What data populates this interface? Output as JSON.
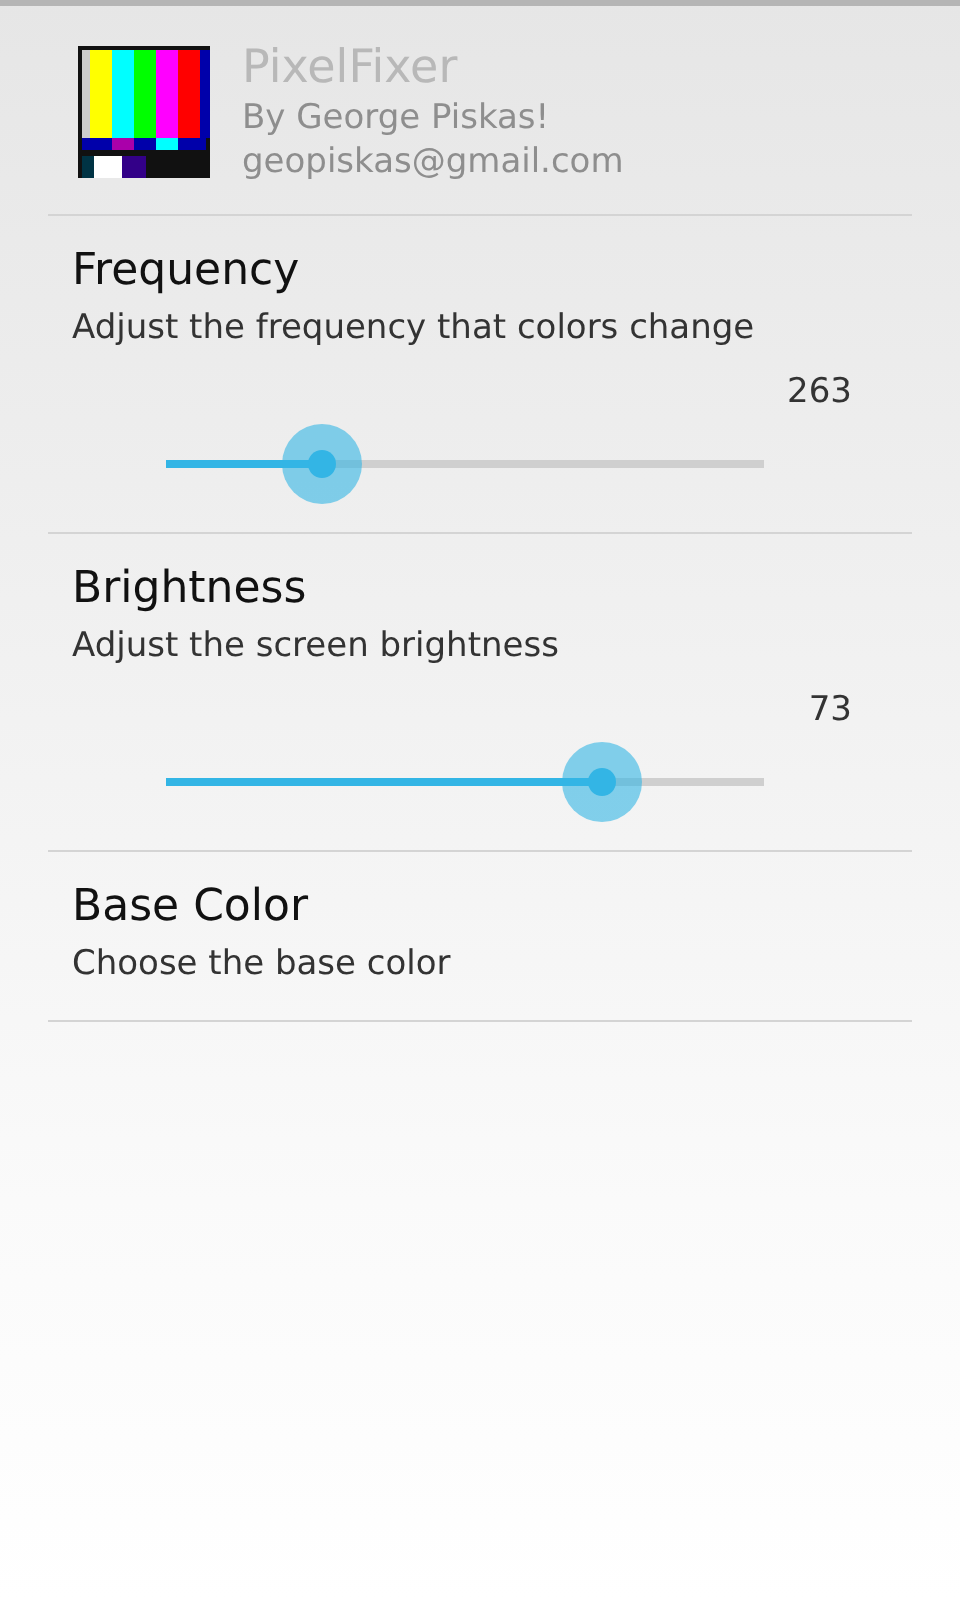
{
  "header": {
    "title": "PixelFixer",
    "author": "By George Piskas!",
    "email": "geopiskas@gmail.com"
  },
  "preferences": [
    {
      "kind": "slider",
      "title": "Frequency",
      "summary": "Adjust the frequency that colors change",
      "reading": "263",
      "level": 0.26
    },
    {
      "kind": "slider",
      "title": "Brightness",
      "summary": "Adjust the screen brightness",
      "reading": "73",
      "level": 0.73
    },
    {
      "kind": "plain",
      "title": "Base Color",
      "summary": "Choose the base color"
    }
  ]
}
